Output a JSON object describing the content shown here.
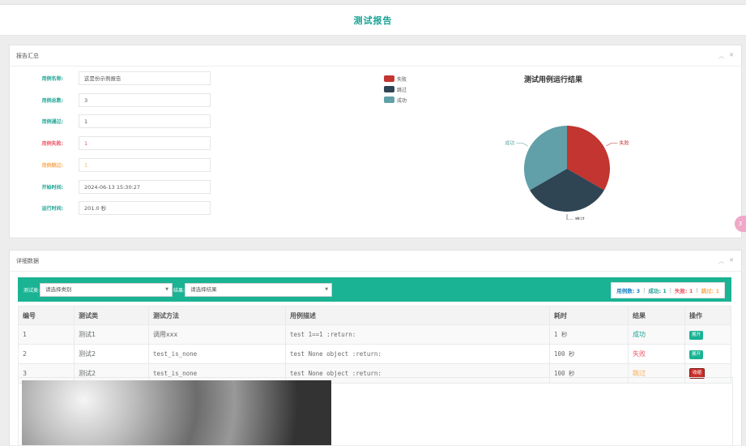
{
  "header": {
    "title": "测试报告"
  },
  "summary": {
    "panel_title": "报告汇总",
    "fields": [
      {
        "label": "用例名称:",
        "value": "这是份示例报告",
        "tone": "green"
      },
      {
        "label": "用例总数:",
        "value": "3",
        "tone": "green"
      },
      {
        "label": "用例通过:",
        "value": "1",
        "tone": "green"
      },
      {
        "label": "用例失败:",
        "value": "1",
        "tone": "red"
      },
      {
        "label": "用例跳过:",
        "value": "1",
        "tone": "orange"
      },
      {
        "label": "开始时间:",
        "value": "2024-06-13 15:30:27",
        "tone": "green"
      },
      {
        "label": "运行时间:",
        "value": "201.0 秒",
        "tone": "green"
      }
    ]
  },
  "chart_data": {
    "type": "pie",
    "title": "测试用例运行结果",
    "categories": [
      "失败",
      "跳过",
      "成功"
    ],
    "values": [
      1,
      1,
      1
    ],
    "colors": [
      "#c23531",
      "#2f4554",
      "#61a0a8"
    ],
    "legend": "top-left"
  },
  "side_badge": {
    "text": "3"
  },
  "detail": {
    "panel_title": "详细数据",
    "filter": {
      "class_label": "测试类:",
      "class_placeholder": "请选择类别",
      "result_label": "结果:",
      "result_placeholder": "请选择结果"
    },
    "stats": {
      "total_label": "用例数:",
      "total": "3",
      "pass_label": "成功:",
      "pass": "1",
      "fail_label": "失败:",
      "fail": "1",
      "skip_label": "跳过:",
      "skip": "1"
    },
    "columns": [
      "编号",
      "测试类",
      "测试方法",
      "用例描述",
      "耗时",
      "结果",
      "操作"
    ],
    "rows": [
      {
        "id": "1",
        "cls": "测试1",
        "method": "调用xxx",
        "desc": "test 1==1 :return:",
        "time": "1 秒",
        "result": "成功",
        "result_tone": "pass",
        "action": "展开",
        "action_tone": "open"
      },
      {
        "id": "2",
        "cls": "测试2",
        "method": "test_is_none",
        "desc": "test None object :return:",
        "time": "100 秒",
        "result": "失败",
        "result_tone": "fail",
        "action": "展开",
        "action_tone": "open"
      },
      {
        "id": "3",
        "cls": "测试2",
        "method": "test_is_none",
        "desc": "test None object :return:",
        "time": "100 秒",
        "result": "跳过",
        "result_tone": "skip",
        "action": "收缩",
        "action_tone": "close"
      }
    ]
  }
}
